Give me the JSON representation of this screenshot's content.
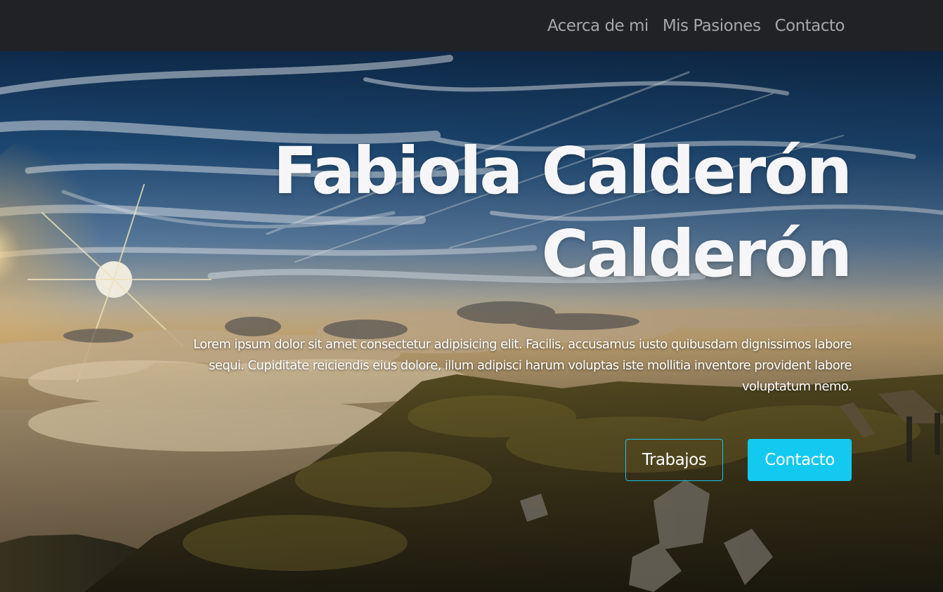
{
  "nav": {
    "items": [
      {
        "label": "Acerca de mi"
      },
      {
        "label": "Mis Pasiones"
      },
      {
        "label": "Contacto"
      }
    ]
  },
  "hero": {
    "title_line1": "Fabiola Calderón",
    "title_line2": "Calderón",
    "description": "Lorem ipsum dolor sit amet consectetur adipisicing elit. Facilis, accusamus iusto quibusdam dignissimos labore sequi. Cupiditate reiciendis eius dolore, illum adipisci harum voluptas iste mollitia inventore provident labore voluptatum nemo.",
    "buttons": {
      "works_label": "Trabajos",
      "contact_label": "Contacto"
    }
  },
  "colors": {
    "navbar_bg": "#202226",
    "nav_link": "#a6a7a9",
    "accent": "#13c9f0",
    "title": "#f6f6f8"
  }
}
